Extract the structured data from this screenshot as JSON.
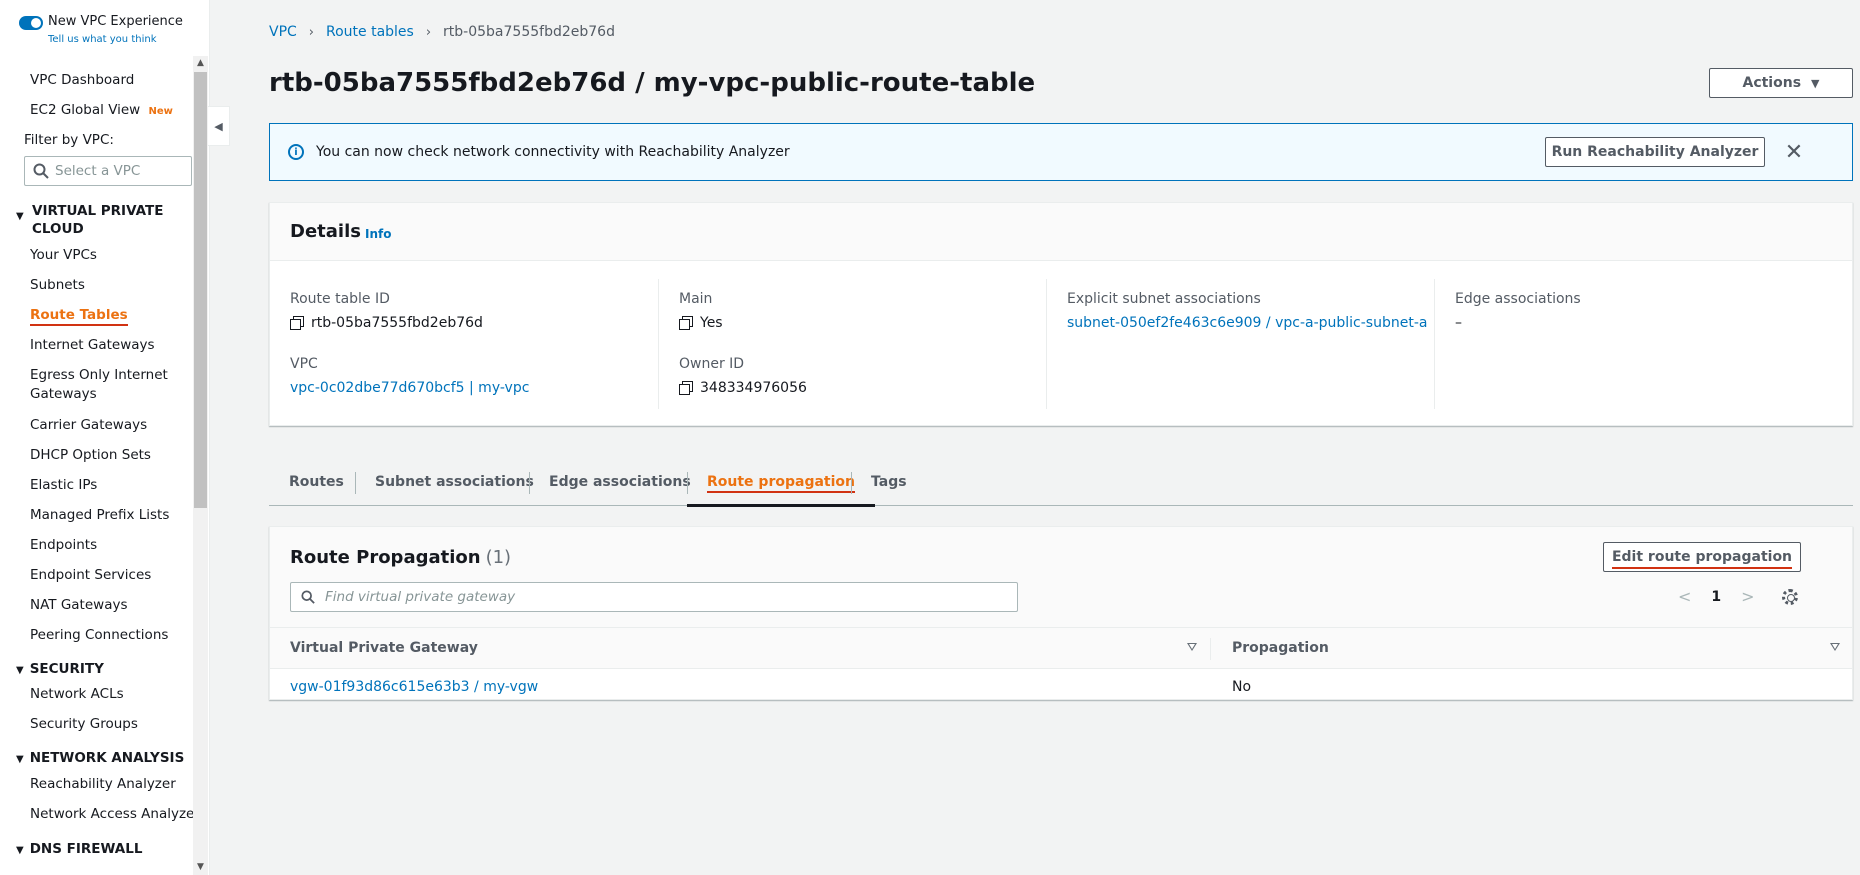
{
  "sidebar": {
    "new_vpc_experience": "New VPC Experience",
    "tell_us": "Tell us what you think",
    "items_top": [
      {
        "label": "VPC Dashboard"
      },
      {
        "label": "EC2 Global View",
        "badge": "New"
      }
    ],
    "filter_label": "Filter by VPC:",
    "filter_placeholder": "Select a VPC",
    "sections": [
      {
        "title": "VIRTUAL PRIVATE CLOUD",
        "title_line1": "VIRTUAL PRIVATE",
        "title_line2": "CLOUD",
        "items": [
          "Your VPCs",
          "Subnets",
          "Route Tables",
          "Internet Gateways",
          "Egress Only Internet",
          "Gateways",
          "Carrier Gateways",
          "DHCP Option Sets",
          "Elastic IPs",
          "Managed Prefix Lists",
          "Endpoints",
          "Endpoint Services",
          "NAT Gateways",
          "Peering Connections"
        ]
      },
      {
        "title": "SECURITY",
        "items": [
          "Network ACLs",
          "Security Groups"
        ]
      },
      {
        "title": "NETWORK ANALYSIS",
        "items": [
          "Reachability Analyzer",
          "Network Access Analyzer"
        ]
      },
      {
        "title": "DNS FIREWALL",
        "items": []
      }
    ]
  },
  "breadcrumb": {
    "items": [
      "VPC",
      "Route tables",
      "rtb-05ba7555fbd2eb76d"
    ]
  },
  "page_title": "rtb-05ba7555fbd2eb76d / my-vpc-public-route-table",
  "actions_label": "Actions",
  "alert": {
    "message": "You can now check network connectivity with Reachability Analyzer",
    "button": "Run Reachability Analyzer"
  },
  "details": {
    "title": "Details",
    "info": "Info",
    "fields": {
      "route_table_id_label": "Route table ID",
      "route_table_id": "rtb-05ba7555fbd2eb76d",
      "vpc_label": "VPC",
      "vpc": "vpc-0c02dbe77d670bcf5 | my-vpc",
      "main_label": "Main",
      "main": "Yes",
      "owner_label": "Owner ID",
      "owner": "348334976056",
      "explicit_label": "Explicit subnet associations",
      "explicit": "subnet-050ef2fe463c6e909 / vpc-a-public-subnet-a",
      "edge_label": "Edge associations",
      "edge": "–"
    }
  },
  "tabs": [
    "Routes",
    "Subnet associations",
    "Edge associations",
    "Route propagation",
    "Tags"
  ],
  "active_tab": "Route propagation",
  "route_propagation": {
    "title": "Route Propagation",
    "count": "(1)",
    "edit_button": "Edit route propagation",
    "search_placeholder": "Find virtual private gateway",
    "page": "1",
    "columns": [
      "Virtual Private Gateway",
      "Propagation"
    ],
    "rows": [
      {
        "gateway": "vgw-01f93d86c615e63b3 / my-vgw",
        "propagation": "No"
      }
    ]
  },
  "colors": {
    "link": "#0073bb",
    "active": "#ec7211",
    "highlight_underline": "#d13212"
  }
}
